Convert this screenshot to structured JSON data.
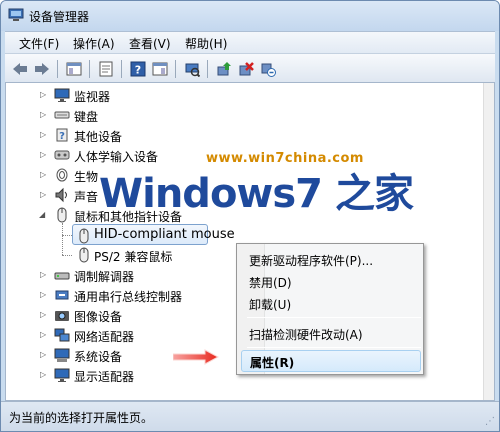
{
  "window": {
    "title": "设备管理器"
  },
  "menu": {
    "items": [
      "文件(F)",
      "操作(A)",
      "查看(V)",
      "帮助(H)"
    ]
  },
  "toolbar": {
    "buttons": [
      "back-icon",
      "forward-icon",
      "show-hide-tree-icon",
      "properties-icon",
      "help-icon",
      "show-hide-console-icon",
      "scan-hardware-icon",
      "update-driver-icon",
      "disable-device-icon",
      "uninstall-device-icon"
    ]
  },
  "tree": {
    "items": [
      {
        "label": "监视器",
        "icon": "monitor-icon",
        "expanded": false
      },
      {
        "label": "键盘",
        "icon": "keyboard-icon",
        "expanded": false
      },
      {
        "label": "其他设备",
        "icon": "other-device-icon",
        "expanded": false
      },
      {
        "label": "人体学输入设备",
        "icon": "hid-icon",
        "expanded": false
      },
      {
        "label": "生物",
        "icon": "biometric-icon",
        "expanded": false
      },
      {
        "label": "声音",
        "icon": "sound-icon",
        "expanded": false
      },
      {
        "label": "鼠标和其他指针设备",
        "icon": "mouse-icon",
        "expanded": true
      },
      {
        "label": "HID-compliant mouse",
        "icon": "mouse-icon",
        "child": true,
        "selected": true
      },
      {
        "label": "PS/2 兼容鼠标",
        "icon": "mouse-icon",
        "child": true
      },
      {
        "label": "调制解调器",
        "icon": "modem-icon",
        "expanded": false
      },
      {
        "label": "通用串行总线控制器",
        "icon": "usb-icon",
        "expanded": false
      },
      {
        "label": "图像设备",
        "icon": "camera-icon",
        "expanded": false
      },
      {
        "label": "网络适配器",
        "icon": "network-icon",
        "expanded": false
      },
      {
        "label": "系统设备",
        "icon": "system-icon",
        "expanded": false
      },
      {
        "label": "显示适配器",
        "icon": "display-adapter-icon",
        "expanded": false
      }
    ]
  },
  "watermark": {
    "url": "www.win7china.com",
    "logo": "Windows7 之家"
  },
  "context_menu": {
    "items": [
      {
        "label": "更新驱动程序软件(P)..."
      },
      {
        "label": "禁用(D)"
      },
      {
        "label": "卸载(U)"
      },
      {
        "label": "扫描检测硬件改动(A)"
      },
      {
        "label": "属性(R)",
        "hovered": true
      }
    ]
  },
  "status_bar": {
    "text": "为当前的选择打开属性页。"
  },
  "colors": {
    "accent": "#1f4a9c",
    "watermark_url": "#d48a00",
    "arrow": "#e8281e",
    "selection": "#dceafa"
  }
}
